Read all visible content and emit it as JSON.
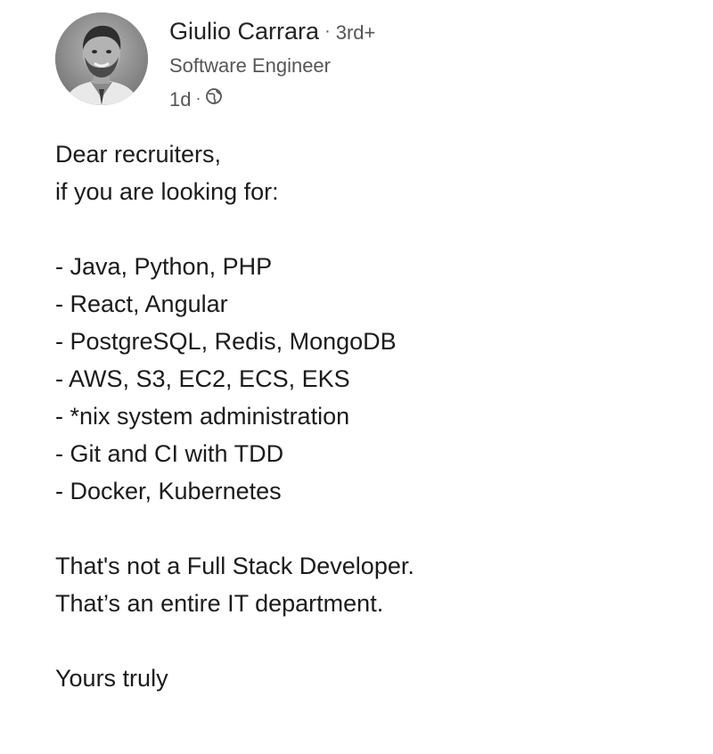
{
  "author": {
    "name": "Giulio Carrara",
    "separator": "·",
    "connection_degree": "3rd+",
    "headline": "Software Engineer",
    "post_age": "1d",
    "visibility_icon": "globe-icon"
  },
  "post": {
    "greeting": "Dear recruiters,",
    "intro": "if you are looking for:",
    "skills": [
      "- Java, Python, PHP",
      "- React, Angular",
      "- PostgreSQL, Redis, MongoDB",
      "- AWS, S3, EC2, ECS, EKS",
      "- *nix system administration",
      "- Git and CI with TDD",
      "- Docker, Kubernetes"
    ],
    "conclusion_line1": "That's not a Full Stack Developer.",
    "conclusion_line2": "That’s an entire IT department.",
    "signoff": "Yours truly"
  },
  "colors": {
    "text": "#1b1b1b",
    "secondary_text": "#565656",
    "background": "#ffffff"
  }
}
